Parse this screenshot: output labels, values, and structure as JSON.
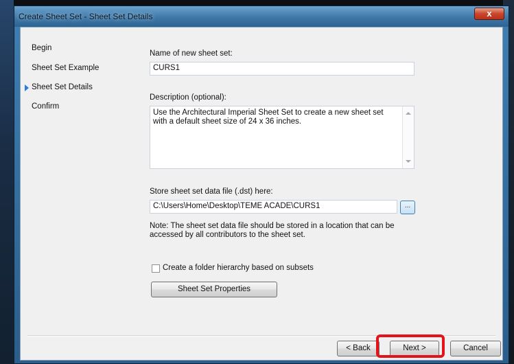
{
  "window": {
    "title": "Create Sheet Set - Sheet Set Details",
    "close_label": "x"
  },
  "nav": {
    "items": [
      {
        "label": "Begin",
        "active": false
      },
      {
        "label": "Sheet Set Example",
        "active": false
      },
      {
        "label": "Sheet Set Details",
        "active": true
      },
      {
        "label": "Confirm",
        "active": false
      }
    ]
  },
  "form": {
    "name_label": "Name of new sheet set:",
    "name_value": "CURS1",
    "description_label": "Description (optional):",
    "description_value": "Use the Architectural Imperial Sheet Set to create a new sheet set with a default sheet size of 24 x 36 inches.",
    "store_label": "Store sheet set data file (.dst) here:",
    "store_value": "C:\\Users\\Home\\Desktop\\TEME ACADE\\CURS1",
    "browse_label": "...",
    "note": "Note: The sheet set data file should be stored in a location that can be accessed by all contributors to the sheet set.",
    "checkbox_label": "Create a folder hierarchy based on subsets",
    "checkbox_checked": false,
    "properties_button": "Sheet Set Properties"
  },
  "footer": {
    "back_label": "< Back",
    "next_label": "Next >",
    "cancel_label": "Cancel"
  },
  "colors": {
    "highlight": "#e3121b",
    "nav_arrow": "#2c7be0"
  }
}
